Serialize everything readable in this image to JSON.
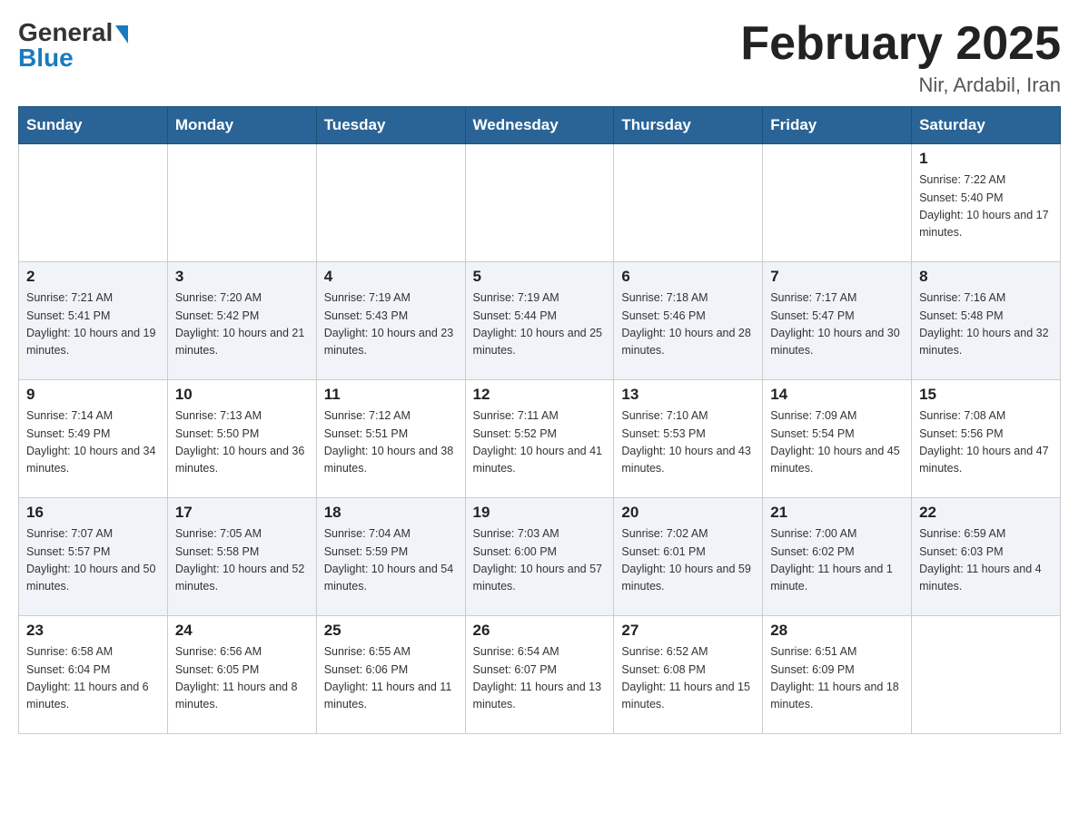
{
  "header": {
    "logo_general": "General",
    "logo_blue": "Blue",
    "title": "February 2025",
    "subtitle": "Nir, Ardabil, Iran"
  },
  "weekdays": [
    "Sunday",
    "Monday",
    "Tuesday",
    "Wednesday",
    "Thursday",
    "Friday",
    "Saturday"
  ],
  "weeks": [
    [
      {
        "day": "",
        "info": ""
      },
      {
        "day": "",
        "info": ""
      },
      {
        "day": "",
        "info": ""
      },
      {
        "day": "",
        "info": ""
      },
      {
        "day": "",
        "info": ""
      },
      {
        "day": "",
        "info": ""
      },
      {
        "day": "1",
        "info": "Sunrise: 7:22 AM\nSunset: 5:40 PM\nDaylight: 10 hours and 17 minutes."
      }
    ],
    [
      {
        "day": "2",
        "info": "Sunrise: 7:21 AM\nSunset: 5:41 PM\nDaylight: 10 hours and 19 minutes."
      },
      {
        "day": "3",
        "info": "Sunrise: 7:20 AM\nSunset: 5:42 PM\nDaylight: 10 hours and 21 minutes."
      },
      {
        "day": "4",
        "info": "Sunrise: 7:19 AM\nSunset: 5:43 PM\nDaylight: 10 hours and 23 minutes."
      },
      {
        "day": "5",
        "info": "Sunrise: 7:19 AM\nSunset: 5:44 PM\nDaylight: 10 hours and 25 minutes."
      },
      {
        "day": "6",
        "info": "Sunrise: 7:18 AM\nSunset: 5:46 PM\nDaylight: 10 hours and 28 minutes."
      },
      {
        "day": "7",
        "info": "Sunrise: 7:17 AM\nSunset: 5:47 PM\nDaylight: 10 hours and 30 minutes."
      },
      {
        "day": "8",
        "info": "Sunrise: 7:16 AM\nSunset: 5:48 PM\nDaylight: 10 hours and 32 minutes."
      }
    ],
    [
      {
        "day": "9",
        "info": "Sunrise: 7:14 AM\nSunset: 5:49 PM\nDaylight: 10 hours and 34 minutes."
      },
      {
        "day": "10",
        "info": "Sunrise: 7:13 AM\nSunset: 5:50 PM\nDaylight: 10 hours and 36 minutes."
      },
      {
        "day": "11",
        "info": "Sunrise: 7:12 AM\nSunset: 5:51 PM\nDaylight: 10 hours and 38 minutes."
      },
      {
        "day": "12",
        "info": "Sunrise: 7:11 AM\nSunset: 5:52 PM\nDaylight: 10 hours and 41 minutes."
      },
      {
        "day": "13",
        "info": "Sunrise: 7:10 AM\nSunset: 5:53 PM\nDaylight: 10 hours and 43 minutes."
      },
      {
        "day": "14",
        "info": "Sunrise: 7:09 AM\nSunset: 5:54 PM\nDaylight: 10 hours and 45 minutes."
      },
      {
        "day": "15",
        "info": "Sunrise: 7:08 AM\nSunset: 5:56 PM\nDaylight: 10 hours and 47 minutes."
      }
    ],
    [
      {
        "day": "16",
        "info": "Sunrise: 7:07 AM\nSunset: 5:57 PM\nDaylight: 10 hours and 50 minutes."
      },
      {
        "day": "17",
        "info": "Sunrise: 7:05 AM\nSunset: 5:58 PM\nDaylight: 10 hours and 52 minutes."
      },
      {
        "day": "18",
        "info": "Sunrise: 7:04 AM\nSunset: 5:59 PM\nDaylight: 10 hours and 54 minutes."
      },
      {
        "day": "19",
        "info": "Sunrise: 7:03 AM\nSunset: 6:00 PM\nDaylight: 10 hours and 57 minutes."
      },
      {
        "day": "20",
        "info": "Sunrise: 7:02 AM\nSunset: 6:01 PM\nDaylight: 10 hours and 59 minutes."
      },
      {
        "day": "21",
        "info": "Sunrise: 7:00 AM\nSunset: 6:02 PM\nDaylight: 11 hours and 1 minute."
      },
      {
        "day": "22",
        "info": "Sunrise: 6:59 AM\nSunset: 6:03 PM\nDaylight: 11 hours and 4 minutes."
      }
    ],
    [
      {
        "day": "23",
        "info": "Sunrise: 6:58 AM\nSunset: 6:04 PM\nDaylight: 11 hours and 6 minutes."
      },
      {
        "day": "24",
        "info": "Sunrise: 6:56 AM\nSunset: 6:05 PM\nDaylight: 11 hours and 8 minutes."
      },
      {
        "day": "25",
        "info": "Sunrise: 6:55 AM\nSunset: 6:06 PM\nDaylight: 11 hours and 11 minutes."
      },
      {
        "day": "26",
        "info": "Sunrise: 6:54 AM\nSunset: 6:07 PM\nDaylight: 11 hours and 13 minutes."
      },
      {
        "day": "27",
        "info": "Sunrise: 6:52 AM\nSunset: 6:08 PM\nDaylight: 11 hours and 15 minutes."
      },
      {
        "day": "28",
        "info": "Sunrise: 6:51 AM\nSunset: 6:09 PM\nDaylight: 11 hours and 18 minutes."
      },
      {
        "day": "",
        "info": ""
      }
    ]
  ]
}
